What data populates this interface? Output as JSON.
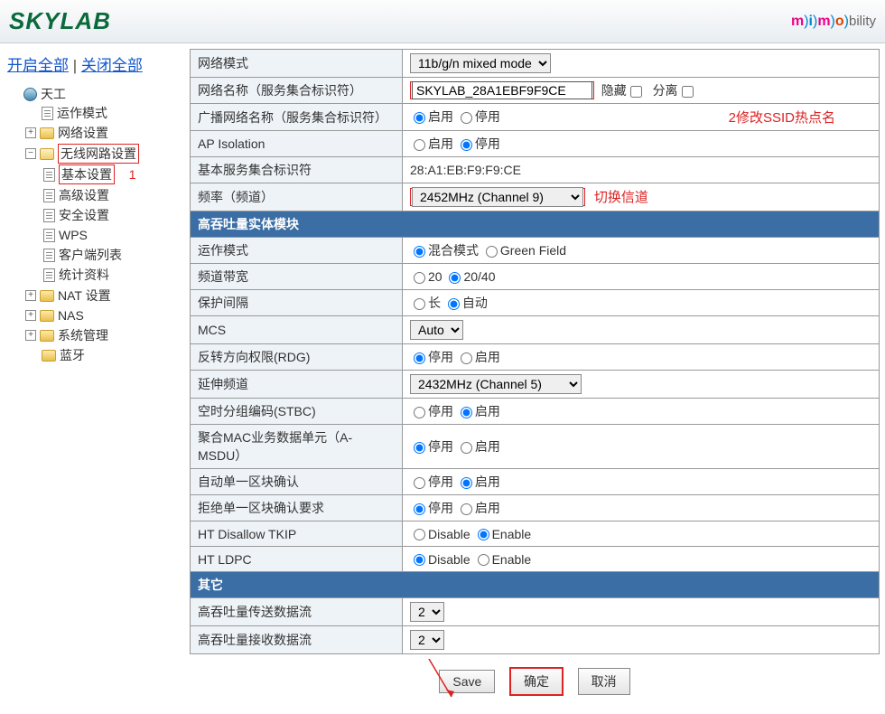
{
  "header": {
    "logo": "SKYLAB",
    "mimobility": "mimobility"
  },
  "top_links": {
    "expand": "开启全部",
    "collapse": "关闭全部"
  },
  "sidebar": {
    "tiangong": "天工",
    "operation_mode": "运作模式",
    "network_settings": "网络设置",
    "wireless_settings": "无线网路设置",
    "basic": "基本设置",
    "advanced": "高级设置",
    "security": "安全设置",
    "wps": "WPS",
    "client_list": "客户端列表",
    "statistics": "统计资料",
    "nat": "NAT 设置",
    "nas": "NAS",
    "system": "系统管理",
    "bluetooth": "蓝牙",
    "annot1": "1"
  },
  "rows": {
    "net_mode": "网络模式",
    "net_mode_val": "11b/g/n mixed mode",
    "ssid_label": "网络名称（服务集合标识符）",
    "ssid_val": "SKYLAB_28A1EBF9F9CE",
    "hide": "隐藏",
    "isolate": "分离",
    "ssid_annot": "2修改SSID热点名",
    "broadcast": "广播网络名称（服务集合标识符）",
    "enable": "启用",
    "disable": "停用",
    "ap_isolation": "AP Isolation",
    "bssid": "基本服务集合标识符",
    "bssid_val": "28:A1:EB:F9:F9:CE",
    "freq": "频率（频道）",
    "freq_val": "2452MHz (Channel 9)",
    "freq_annot": "切换信道",
    "section_ht": "高吞吐量实体模块",
    "op_mode": "运作模式",
    "mixed_mode": "混合模式",
    "green_field": "Green Field",
    "bw": "频道带宽",
    "bw_20": "20",
    "bw_2040": "20/40",
    "gi": "保护间隔",
    "gi_long": "长",
    "gi_auto": "自动",
    "mcs": "MCS",
    "mcs_val": "Auto",
    "rdg": "反转方向权限(RDG)",
    "stop": "停用",
    "start": "启用",
    "ext_ch": "延伸频道",
    "ext_ch_val": "2432MHz (Channel 5)",
    "stbc": "空时分组编码(STBC)",
    "amsdu": "聚合MAC业务数据单元（A-MSDU）",
    "autoba": "自动单一区块确认",
    "declineba": "拒绝单一区块确认要求",
    "disallow_tkip": "HT Disallow TKIP",
    "disable_en": "Disable",
    "enable_en": "Enable",
    "ldpc": "HT LDPC",
    "section_other": "其它",
    "tx_streams": "高吞吐量传送数据流",
    "rx_streams": "高吞吐量接收数据流",
    "stream_val": "2"
  },
  "buttons": {
    "save": "Save",
    "ok": "确定",
    "cancel": "取消"
  }
}
